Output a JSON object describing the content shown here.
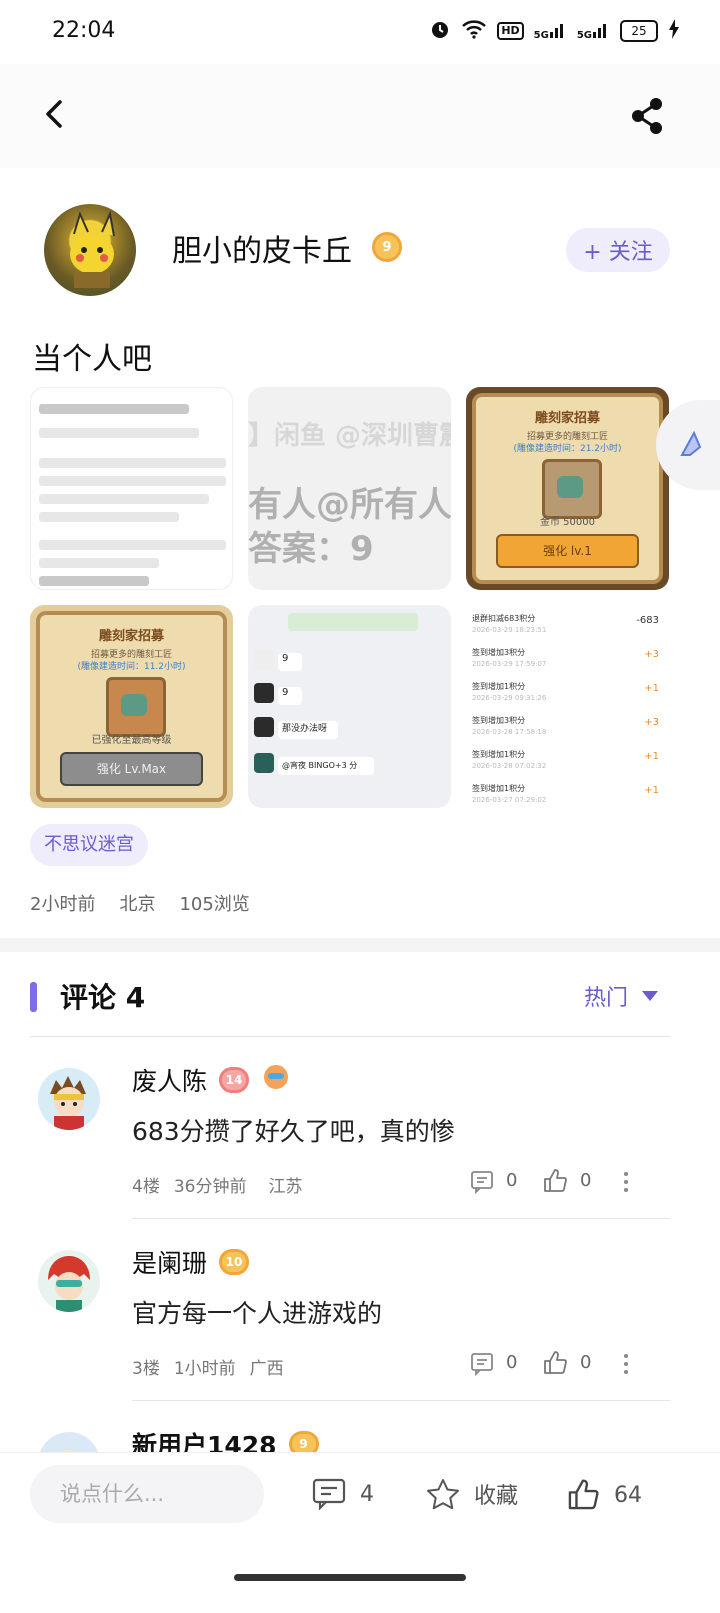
{
  "status_bar": {
    "time": "22:04",
    "network": "HD",
    "sig1": "5G",
    "sig2": "5G",
    "battery": "25"
  },
  "post": {
    "author": {
      "name": "胆小的皮卡丘",
      "level": "9",
      "follow_label": "+ 关注"
    },
    "title": "当个人吧",
    "thumb2_lines": [
      "】闲鱼 @深圳曹震",
      "有人@所有人答题",
      "答案：9"
    ],
    "thumb3": {
      "title": "雕刻家招募",
      "subtitle": "招募更多的雕刻工匠",
      "sub2": "(雕像建造时间：21.2小时)",
      "coins": "金币 50000",
      "button": "强化 lv.1"
    },
    "thumb4": {
      "title": "雕刻家招募",
      "subtitle": "招募更多的雕刻工匠",
      "sub2": "(雕像建造时间：11.2小时)",
      "note": "已强化至最高等级",
      "button": "强化 Lv.Max"
    },
    "thumb5_msgs": [
      "9",
      "9",
      "那没办法呀",
      "@宵夜 BINGO+3 分"
    ],
    "thumb6_rows": [
      {
        "label": "退群扣减683积分",
        "date": "2026-03-29 18:23:51",
        "value": "-683"
      },
      {
        "label": "签到增加3积分",
        "date": "2026-03-29 17:59:07",
        "value": "+3"
      },
      {
        "label": "签到增加1积分",
        "date": "2026-03-29 09:31:26",
        "value": "+1"
      },
      {
        "label": "签到增加3积分",
        "date": "2026-03-28 17:58:18",
        "value": "+3"
      },
      {
        "label": "签到增加1积分",
        "date": "2026-03-28 07:02:32",
        "value": "+1"
      },
      {
        "label": "签到增加1积分",
        "date": "2026-03-27 07:29:02",
        "value": "+1"
      }
    ],
    "tag": "不思议迷宫",
    "time_ago": "2小时前",
    "location": "北京",
    "views": "105浏览"
  },
  "comments_header": {
    "title": "评论 4",
    "sort": "热门"
  },
  "comments": [
    {
      "name": "废人陈",
      "level": "14",
      "text": "683分攒了好久了吧，真的惨",
      "floor": "4楼",
      "time": "36分钟前",
      "region": "江苏",
      "replies": "0",
      "likes": "0"
    },
    {
      "name": "是阑珊",
      "level": "10",
      "text": "官方每一个人进游戏的",
      "floor": "3楼",
      "time": "1小时前",
      "region": "广西",
      "replies": "0",
      "likes": "0"
    },
    {
      "name": "新用户1428",
      "level": "9"
    }
  ],
  "bottom_bar": {
    "placeholder": "说点什么...",
    "comment_count": "4",
    "favorite_label": "收藏",
    "like_count": "64"
  }
}
